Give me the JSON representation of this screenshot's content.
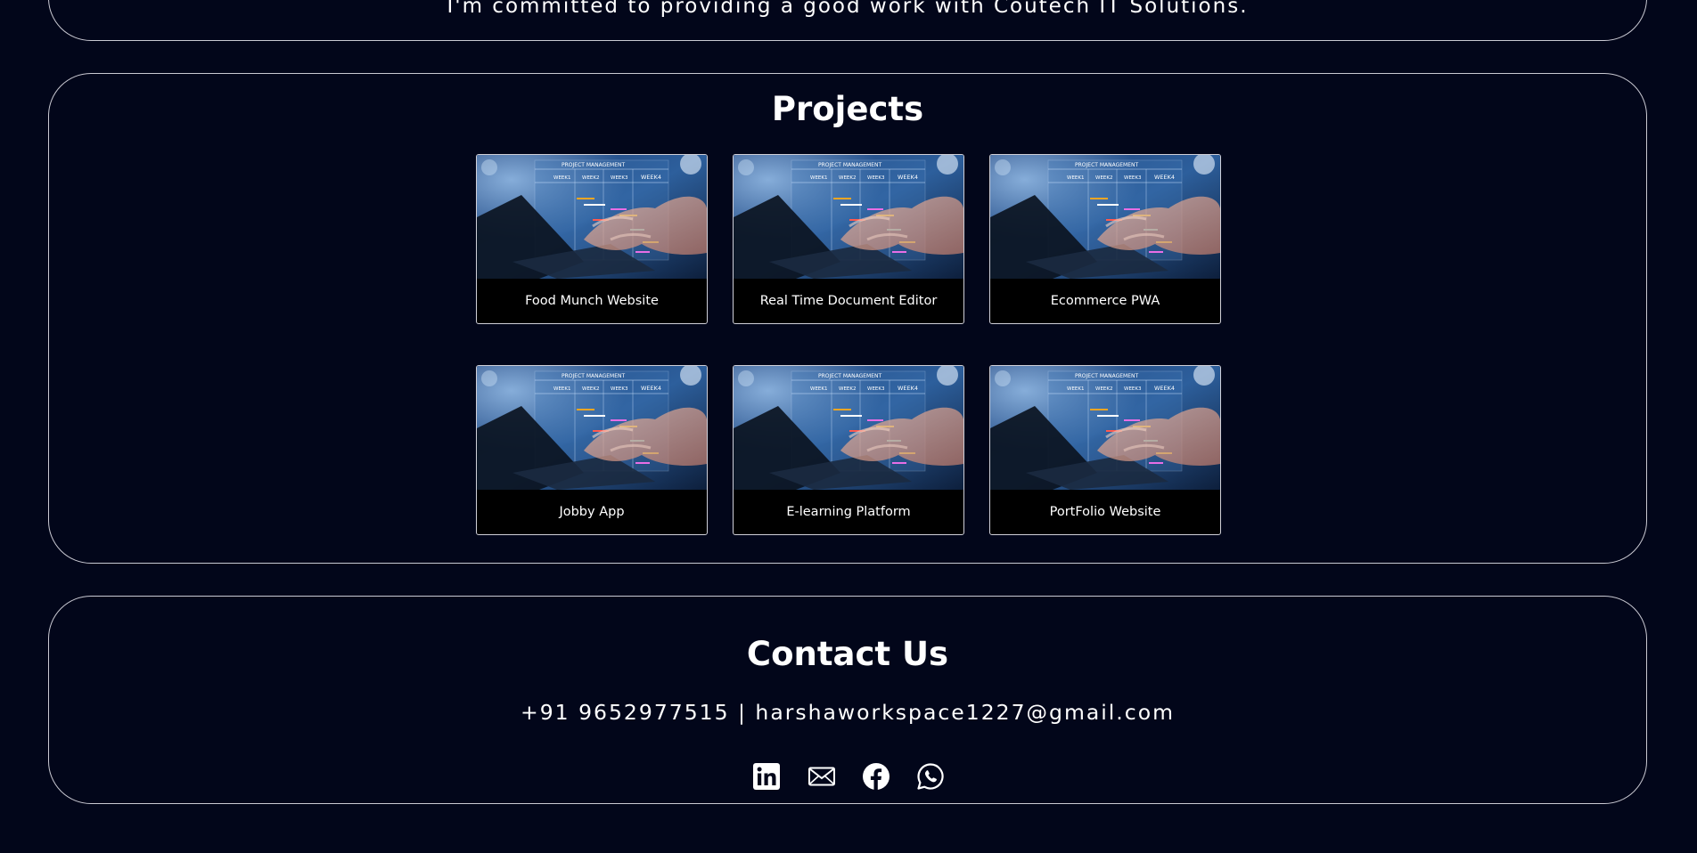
{
  "about": {
    "text": "I'm committed to providing a good work with Coutech IT Solutions."
  },
  "projects": {
    "title": "Projects",
    "items": [
      {
        "label": "Food Munch Website"
      },
      {
        "label": "Real Time Document Editor"
      },
      {
        "label": "Ecommerce PWA"
      },
      {
        "label": "Jobby App"
      },
      {
        "label": "E-learning Platform"
      },
      {
        "label": "PortFolio Website"
      }
    ],
    "thumbnail": {
      "heading": "PROJECT MANAGEMENT",
      "weeks": [
        "WEEK1",
        "WEEK2",
        "WEEK3",
        "WEEK4"
      ]
    }
  },
  "contact": {
    "title": "Contact Us",
    "line": "+91 9652977515 | harshaworkspace1227@gmail.com",
    "social_icons": [
      "linkedin-icon",
      "mail-icon",
      "facebook-icon",
      "whatsapp-icon"
    ]
  },
  "colors": {
    "background": "#02061a",
    "border": "#c9c9d2",
    "text": "#ffffff",
    "card_label_bg": "#000000"
  }
}
